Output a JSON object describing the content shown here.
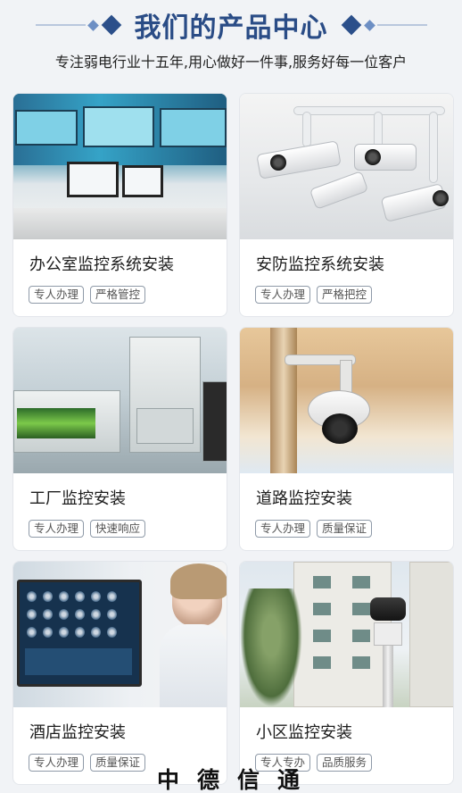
{
  "header": {
    "title": "我们的产品中心",
    "subtitle": "专注弱电行业十五年,用心做好一件事,服务好每一位客户"
  },
  "products": [
    {
      "title": "办公室监控系统安装",
      "tags": [
        "专人办理",
        "严格管控"
      ],
      "image": "office-control-room"
    },
    {
      "title": "安防监控系统安装",
      "tags": [
        "专人办理",
        "严格把控"
      ],
      "image": "security-cameras"
    },
    {
      "title": "工厂监控安装",
      "tags": [
        "专人办理",
        "快速响应"
      ],
      "image": "factory-line"
    },
    {
      "title": "道路监控安装",
      "tags": [
        "专人办理",
        "质量保证"
      ],
      "image": "road-dome-camera"
    },
    {
      "title": "酒店监控安装",
      "tags": [
        "专人办理",
        "质量保证"
      ],
      "image": "hotel-monitor"
    },
    {
      "title": "小区监控安装",
      "tags": [
        "专人专办",
        "品质服务"
      ],
      "image": "district-camera"
    }
  ],
  "footer": {
    "brand": [
      "中",
      "德",
      "信",
      "通"
    ]
  },
  "colors": {
    "title": "#2a4c86",
    "background": "#f1f3f6",
    "tag_border": "#8f9aa8"
  }
}
